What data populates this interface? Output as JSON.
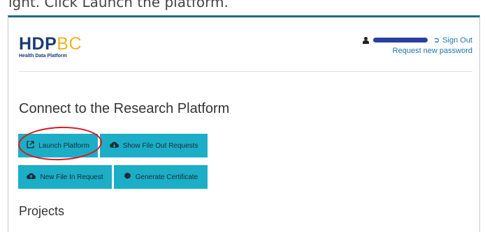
{
  "caption": "ight. Click Launch the platform.",
  "logo": {
    "hdp": "HDP",
    "bc": "BC",
    "subtitle": "Health Data Platform"
  },
  "user": {
    "icon": "user-icon",
    "sign_out_label": "Sign Out",
    "sign_out_icon": "sign-out-icon",
    "request_password_label": "Request new password"
  },
  "page": {
    "title": "Connect to the Research Platform",
    "projects_title": "Projects"
  },
  "buttons": {
    "launch": {
      "label": "Launch Platform",
      "icon": "external-link-icon"
    },
    "file_out": {
      "label": "Show File Out Requests",
      "icon": "cloud-download-icon"
    },
    "new_file_in": {
      "label": "New File In Request",
      "icon": "cloud-upload-icon"
    },
    "certificate": {
      "label": "Generate Certificate",
      "icon": "certificate-icon"
    }
  },
  "colors": {
    "button_bg": "#1baec6",
    "logo_primary": "#1a3b73",
    "logo_accent": "#f0b323",
    "link": "#1b74b3",
    "annotation": "#e0141e"
  }
}
